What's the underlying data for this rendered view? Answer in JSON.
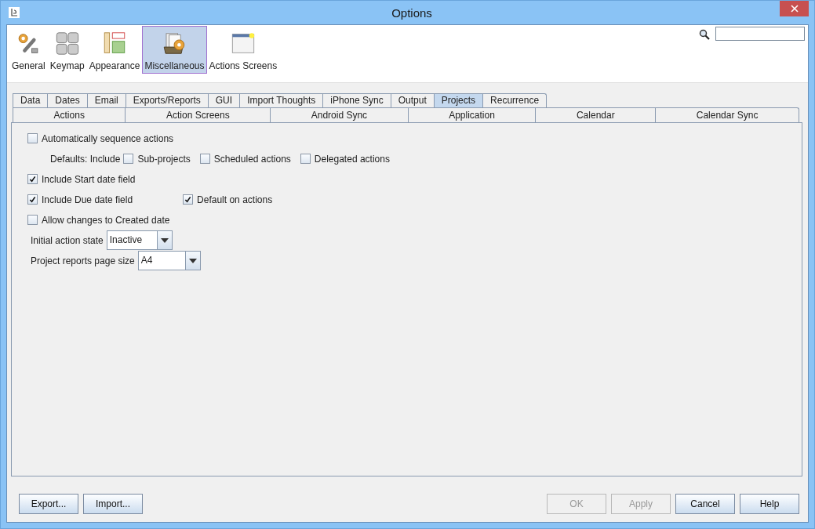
{
  "window": {
    "title": "Options"
  },
  "categories": [
    {
      "label": "General",
      "selected": false
    },
    {
      "label": "Keymap",
      "selected": false
    },
    {
      "label": "Appearance",
      "selected": false
    },
    {
      "label": "Miscellaneous",
      "selected": true
    },
    {
      "label": "Actions Screens",
      "selected": false
    }
  ],
  "tabs_row_1": [
    {
      "label": "Data",
      "selected": false
    },
    {
      "label": "Dates",
      "selected": false
    },
    {
      "label": "Email",
      "selected": false
    },
    {
      "label": "Exports/Reports",
      "selected": false
    },
    {
      "label": "GUI",
      "selected": false
    },
    {
      "label": "Import Thoughts",
      "selected": false
    },
    {
      "label": "iPhone Sync",
      "selected": false
    },
    {
      "label": "Output",
      "selected": false
    },
    {
      "label": "Projects",
      "selected": true
    },
    {
      "label": "Recurrence",
      "selected": false
    }
  ],
  "tabs_row_2": [
    {
      "label": "Actions",
      "selected": false
    },
    {
      "label": "Action Screens",
      "selected": false
    },
    {
      "label": "Android Sync",
      "selected": false
    },
    {
      "label": "Application",
      "selected": false
    },
    {
      "label": "Calendar",
      "selected": false
    },
    {
      "label": "Calendar Sync",
      "selected": false
    }
  ],
  "rows": [
    {
      "kind": "main",
      "items": [
        {
          "kind": "checkbox",
          "label": "Automatically sequence actions",
          "checked": false
        }
      ]
    },
    {
      "kind": "sub",
      "items": [
        {
          "kind": "label",
          "label": "Defaults: Include"
        },
        {
          "kind": "checkbox",
          "label": "Sub-projects",
          "checked": false
        },
        {
          "kind": "checkbox",
          "label": "Scheduled actions",
          "checked": false
        },
        {
          "kind": "checkbox",
          "label": "Delegated actions",
          "checked": false
        }
      ]
    },
    {
      "kind": "main",
      "items": [
        {
          "kind": "checkbox",
          "label": "Include Start date field",
          "checked": true
        }
      ]
    },
    {
      "kind": "main",
      "items": [
        {
          "kind": "checkbox",
          "label": "Include Due date field",
          "checked": true
        },
        {
          "kind": "checkbox",
          "label": "Default on actions",
          "checked": true
        }
      ]
    },
    {
      "kind": "main",
      "items": [
        {
          "kind": "checkbox",
          "label": "Allow changes to Created date",
          "checked": false
        }
      ]
    },
    {
      "kind": "main",
      "items": [
        {
          "kind": "label",
          "label": "Initial action state"
        },
        {
          "kind": "combo",
          "value": "Inactive"
        }
      ]
    },
    {
      "kind": "main",
      "items": [
        {
          "kind": "label",
          "label": "Project reports page size"
        },
        {
          "kind": "combo",
          "value": "A4"
        }
      ]
    }
  ],
  "left_buttons": [
    {
      "label": "Export...",
      "disabled": false
    },
    {
      "label": "Import...",
      "disabled": false
    }
  ],
  "right_buttons": [
    {
      "label": "OK",
      "disabled": true
    },
    {
      "label": "Apply",
      "disabled": true
    },
    {
      "label": "Cancel",
      "disabled": false
    },
    {
      "label": "Help",
      "disabled": false
    }
  ]
}
